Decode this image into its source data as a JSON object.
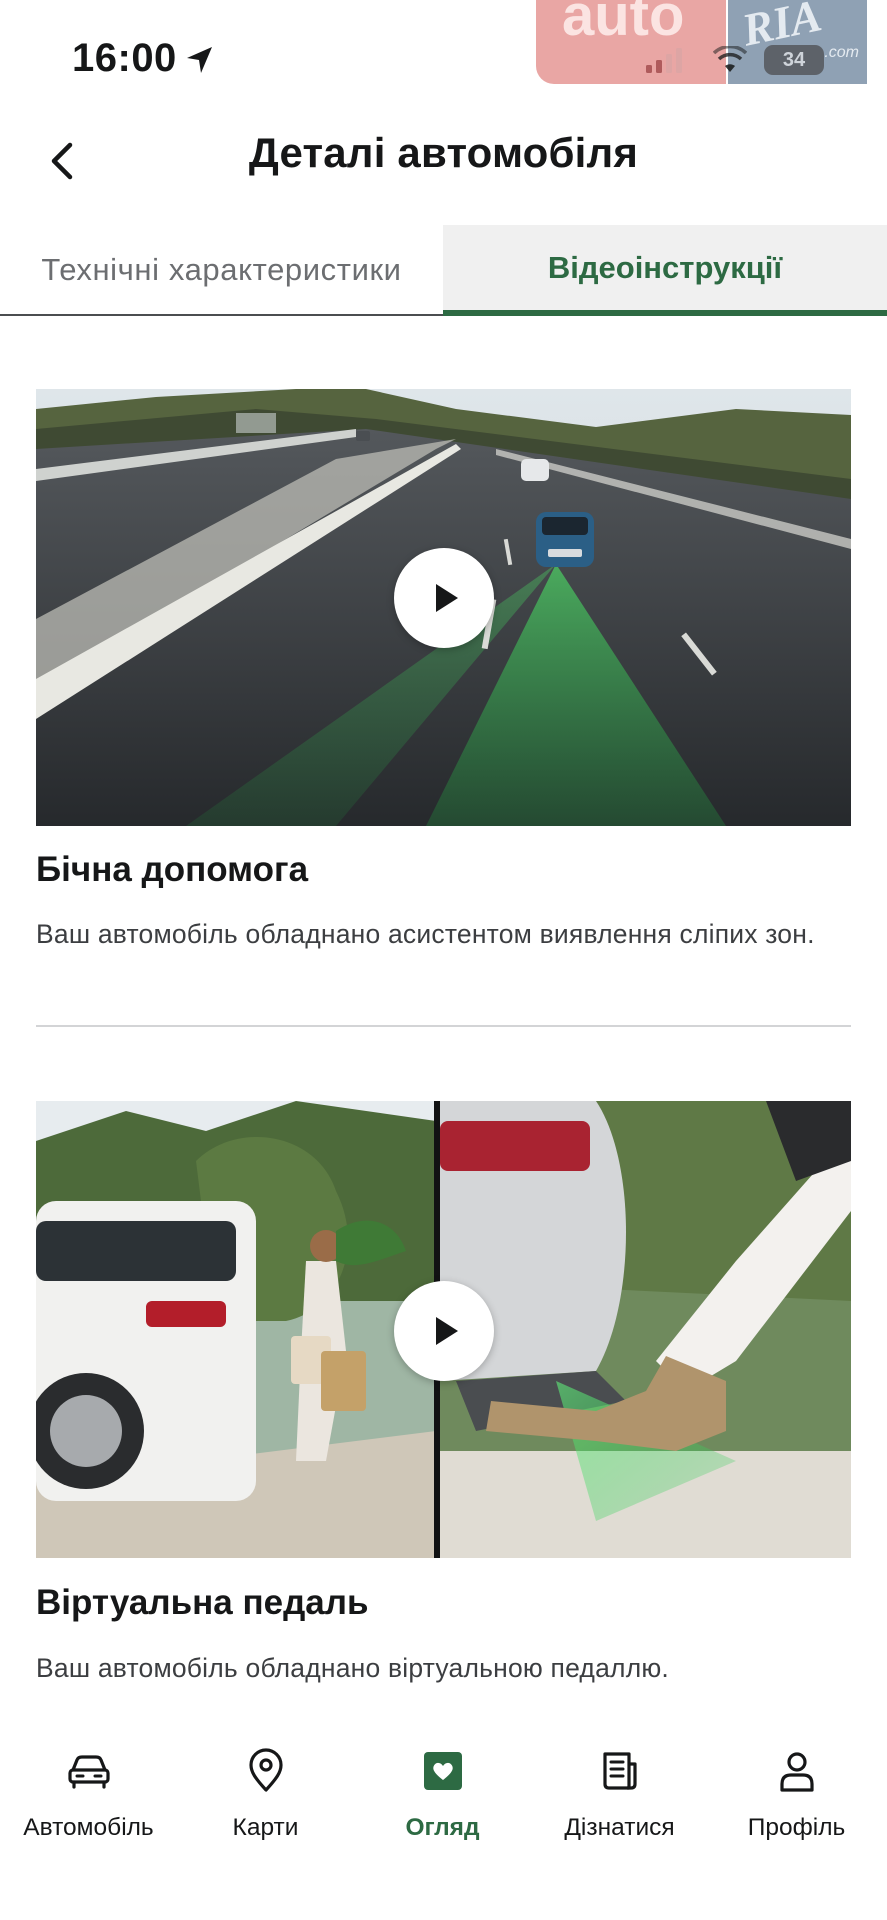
{
  "status_bar": {
    "time": "16:00",
    "battery": "34",
    "watermark_auto": "auto",
    "watermark_ria": "RIA",
    "watermark_domain": ".com"
  },
  "header": {
    "title": "Деталі автомобіля",
    "back_icon": "chevron-left-icon"
  },
  "tabs": [
    {
      "label": "Технічні характеристики",
      "active": false
    },
    {
      "label": "Відеоінструкції",
      "active": true
    }
  ],
  "videos": [
    {
      "title": "Бічна допомога",
      "description": "Ваш автомобіль обладнано асистентом виявлення сліпих зон.",
      "thumbnail_icon": "highway-blind-spot-image"
    },
    {
      "title": "Віртуальна педаль",
      "description": "Ваш автомобіль обладнано віртуальною педаллю.",
      "thumbnail_icon": "virtual-pedal-image"
    }
  ],
  "bottom_nav": [
    {
      "label": "Автомобіль",
      "icon": "car-icon",
      "active": false
    },
    {
      "label": "Карти",
      "icon": "map-pin-icon",
      "active": false
    },
    {
      "label": "Огляд",
      "icon": "heart-square-icon",
      "active": true
    },
    {
      "label": "Дізнатися",
      "icon": "document-icon",
      "active": false
    },
    {
      "label": "Профіль",
      "icon": "user-icon",
      "active": false
    }
  ],
  "colors": {
    "accent": "#2d6a43",
    "text": "#161718",
    "tab_bg": "#f0f0f0"
  }
}
